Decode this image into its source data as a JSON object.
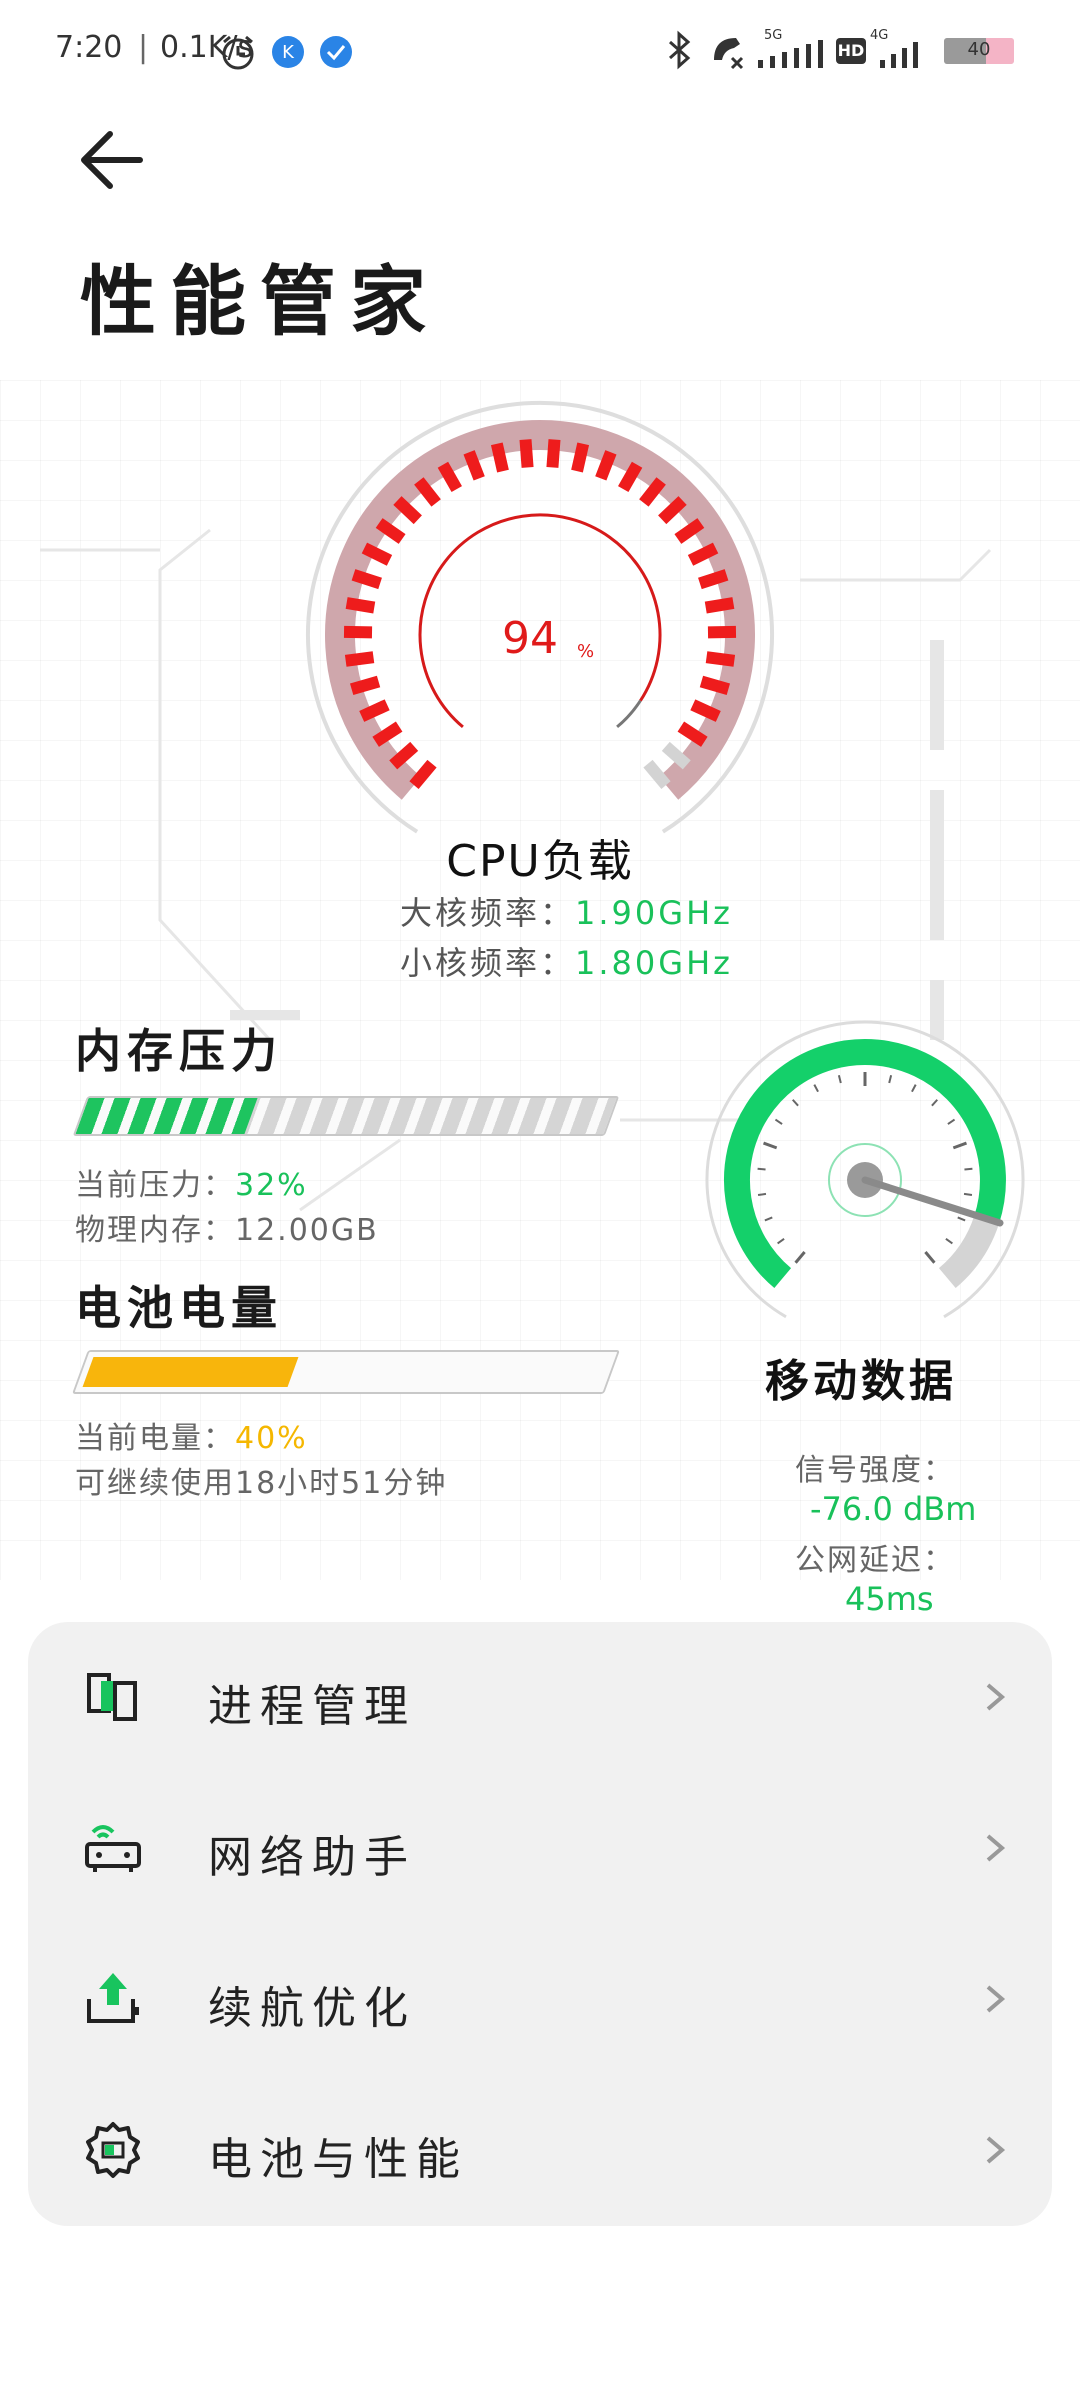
{
  "status_bar": {
    "time": "7:20",
    "speed": "0.1K/s",
    "net_5g": "5G",
    "net_hd": "HD",
    "net_4g": "4G",
    "battery": "40"
  },
  "header": {
    "title": "性能管家"
  },
  "cpu": {
    "value": "94",
    "unit": "%",
    "level_fraction": 0.94,
    "label": "CPU负载",
    "big_core_label": "大核频率：",
    "big_core_value": "1.90GHz",
    "small_core_label": "小核频率：",
    "small_core_value": "1.80GHz"
  },
  "memory": {
    "title": "内存压力",
    "pressure_label": "当前压力：",
    "pressure_value": "32%",
    "pressure_fraction": 0.32,
    "physical_label": "物理内存：",
    "physical_value": "12.00GB"
  },
  "battery": {
    "title": "电池电量",
    "level_label": "当前电量：",
    "level_value": "40%",
    "level_fraction": 0.4,
    "remaining_text": "可继续使用18小时51分钟"
  },
  "mobile_data": {
    "title": "移动数据",
    "signal_label": "信号强度：",
    "signal_value": "-76.0 dBm",
    "latency_label": "公网延迟：",
    "latency_value": "45ms"
  },
  "menu": {
    "items": [
      {
        "label": "进程管理",
        "icon": "process-icon"
      },
      {
        "label": "网络助手",
        "icon": "router-icon"
      },
      {
        "label": "续航优化",
        "icon": "battery-upload-icon"
      },
      {
        "label": "电池与性能",
        "icon": "gear-battery-icon"
      }
    ]
  },
  "colors": {
    "cpu_red": "#ee1c1c",
    "green": "#19c15a",
    "yellow": "#f5b700",
    "card_bg": "#f1f1f1"
  }
}
